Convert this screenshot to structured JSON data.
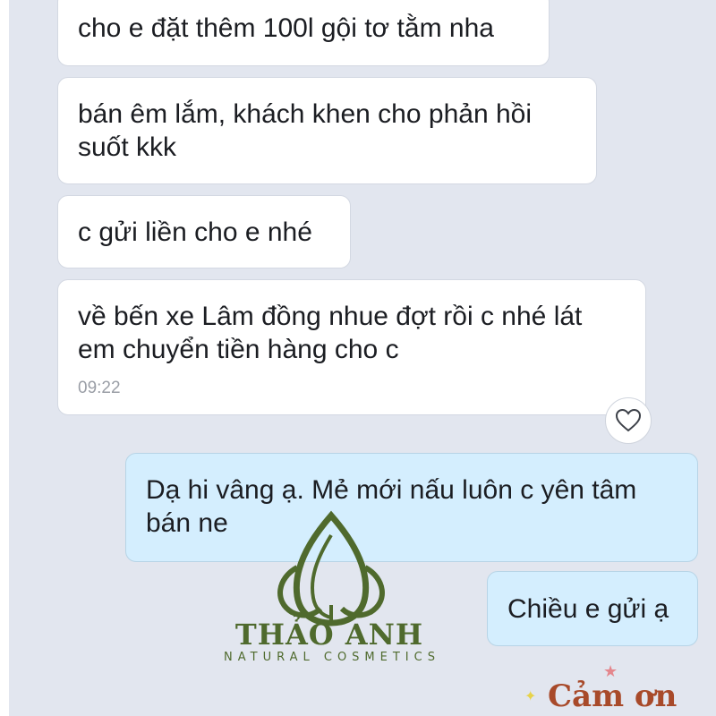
{
  "messages": [
    {
      "direction": "incoming",
      "lines": [
        "cho e đặt thêm 100l gội tơ tằm nha"
      ],
      "time": ""
    },
    {
      "direction": "incoming",
      "lines": [
        "bán êm lắm, khách khen cho phản hồi",
        "suốt kkk"
      ],
      "time": ""
    },
    {
      "direction": "incoming",
      "lines": [
        "c gửi liền cho e nhé"
      ],
      "time": ""
    },
    {
      "direction": "incoming",
      "lines": [
        "về bến xe Lâm đồng nhue đợt rồi c nhé lát",
        "em chuyển tiền hàng cho c"
      ],
      "time": "09:22"
    },
    {
      "direction": "outgoing",
      "lines": [
        "Dạ hi vâng ạ. Mẻ mới nấu luôn c yên tâm",
        "bán ne"
      ],
      "time": ""
    },
    {
      "direction": "outgoing",
      "lines": [
        "Chiều e gửi ạ"
      ],
      "time": ""
    }
  ],
  "reaction": {
    "icon": "heart-icon"
  },
  "watermark": {
    "brand": "THẢO ANH",
    "tagline": "NATURAL COSMETICS"
  },
  "sticker": {
    "text": "Cảm ơn"
  },
  "colors": {
    "chat_bg": "#e2e6ef",
    "incoming_bubble": "#ffffff",
    "outgoing_bubble": "#d4eefe",
    "brand_green": "#4f6a2d",
    "time_gray": "#9a9ea6"
  }
}
